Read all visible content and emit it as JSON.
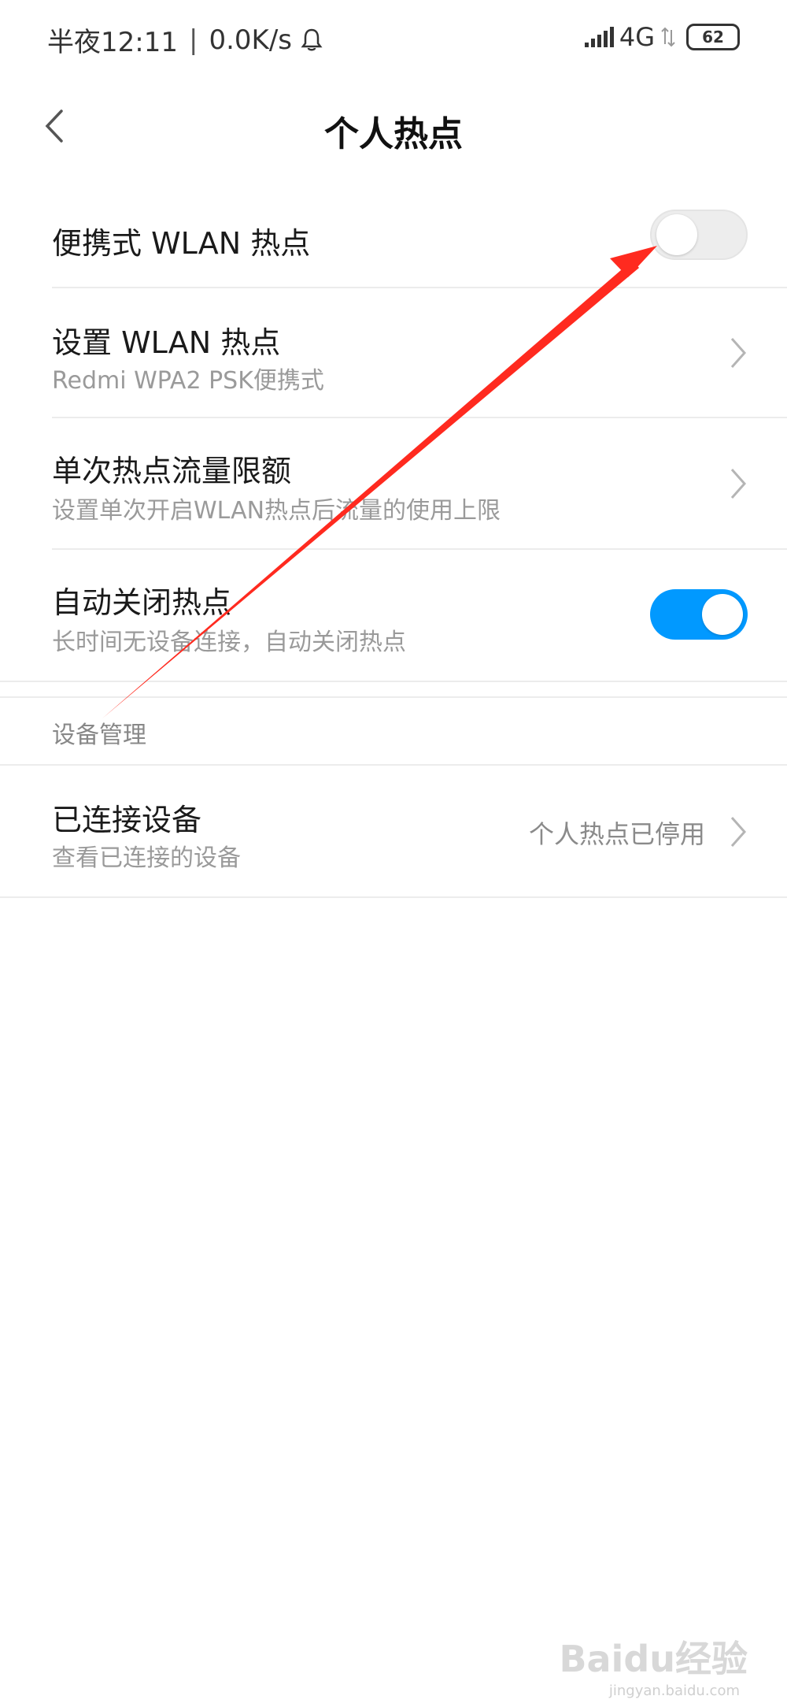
{
  "status_bar": {
    "time": "半夜12:11",
    "speed": "0.0K/s",
    "network": "4G",
    "battery": "62"
  },
  "header": {
    "title": "个人热点"
  },
  "settings": {
    "portable_hotspot": {
      "label": "便携式 WLAN 热点",
      "enabled": false
    },
    "setup_hotspot": {
      "label": "设置 WLAN 热点",
      "subtitle": "Redmi WPA2 PSK便携式"
    },
    "data_limit": {
      "label": "单次热点流量限额",
      "subtitle": "设置单次开启WLAN热点后流量的使用上限"
    },
    "auto_off": {
      "label": "自动关闭热点",
      "subtitle": "长时间无设备连接，自动关闭热点",
      "enabled": true
    }
  },
  "device_section": {
    "header": "设备管理",
    "connected": {
      "label": "已连接设备",
      "subtitle": "查看已连接的设备",
      "value": "个人热点已停用"
    }
  },
  "watermark": {
    "brand": "Baidu经验",
    "url": "jingyan.baidu.com"
  },
  "colors": {
    "accent": "#0199ff",
    "arrow": "#ff2a1f"
  }
}
